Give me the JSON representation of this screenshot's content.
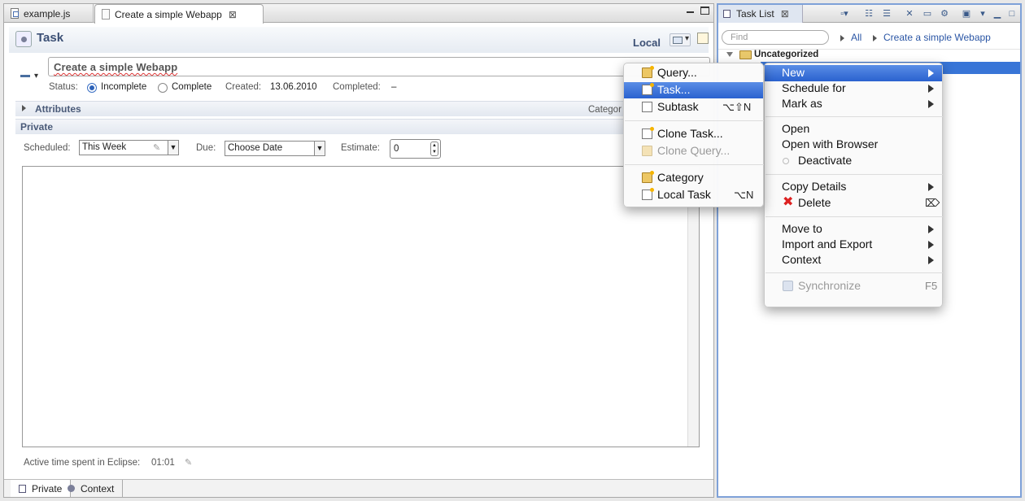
{
  "editor": {
    "tabs": [
      {
        "label": "example.js"
      },
      {
        "label": "Create a simple Webapp",
        "close": "⊠"
      }
    ],
    "header_title": "Task",
    "local_label": "Local",
    "summary": "Create a simple Webapp",
    "status_label": "Status:",
    "status_options": [
      "Incomplete",
      "Complete"
    ],
    "status_selected": "Incomplete",
    "created_label": "Created:",
    "created_value": "13.06.2010",
    "completed_label": "Completed:",
    "completed_value": "–",
    "attributes_label": "Attributes",
    "category_label": "Categor",
    "private_label": "Private",
    "scheduled_label": "Scheduled:",
    "scheduled_value": "This Week",
    "due_label": "Due:",
    "due_value": "Choose Date",
    "estimate_label": "Estimate:",
    "estimate_value": "0",
    "active_time_label": "Active time spent in Eclipse:",
    "active_time_value": "01:01",
    "bottom_tabs": [
      "Private",
      "Context"
    ]
  },
  "tasklist": {
    "title": "Task List",
    "find_placeholder": "Find",
    "breadcrumbs": [
      "All",
      "Create a simple Webapp"
    ],
    "category": "Uncategorized"
  },
  "context_menu": {
    "items": [
      {
        "label": "New",
        "submenu": true,
        "highlighted": true
      },
      {
        "label": "Schedule for",
        "submenu": true
      },
      {
        "label": "Mark as",
        "submenu": true
      },
      {
        "label": "Open"
      },
      {
        "label": "Open with Browser"
      },
      {
        "label": "Deactivate",
        "icon": "radio-empty-icon"
      },
      {
        "label": "Copy Details",
        "submenu": true
      },
      {
        "label": "Delete",
        "icon": "delete-icon",
        "shortcut": "⌦"
      },
      {
        "label": "Move to",
        "submenu": true
      },
      {
        "label": "Import and Export",
        "submenu": true
      },
      {
        "label": "Context",
        "submenu": true
      },
      {
        "label": "Synchronize",
        "icon": "sync-icon",
        "shortcut": "F5",
        "disabled": true
      }
    ]
  },
  "new_submenu": {
    "items": [
      {
        "label": "Query...",
        "icon": "query-folder-icon"
      },
      {
        "label": "Task...",
        "icon": "task-doc-icon",
        "highlighted": true
      },
      {
        "label": "Subtask",
        "icon": "subtask-doc-icon",
        "shortcut": "⌥⇧N"
      },
      {
        "label": "Clone Task...",
        "icon": "clone-task-icon"
      },
      {
        "label": "Clone Query...",
        "icon": "clone-query-icon",
        "disabled": true
      },
      {
        "label": "Category",
        "icon": "category-folder-icon"
      },
      {
        "label": "Local Task",
        "icon": "local-task-icon",
        "shortcut": "⌥N"
      }
    ]
  },
  "colors": {
    "selection": "#3875d7",
    "link": "#2b56a5",
    "header_text": "#3c5075"
  }
}
